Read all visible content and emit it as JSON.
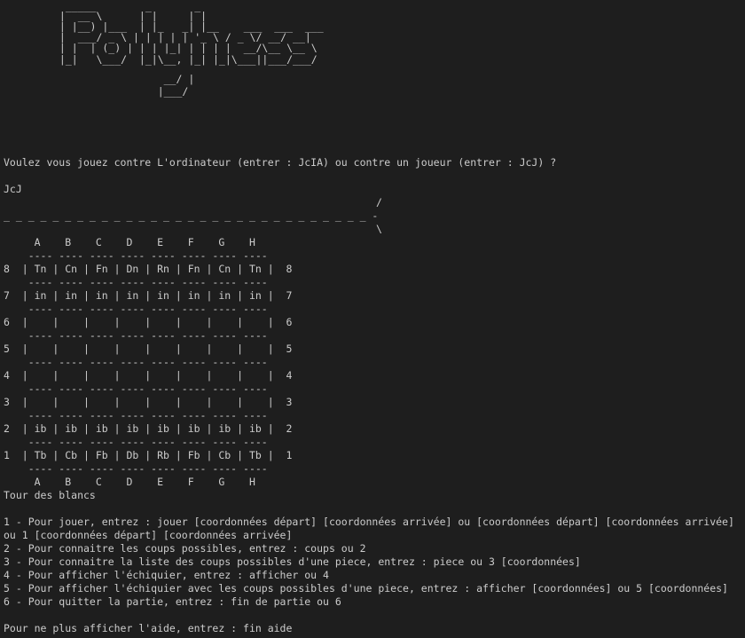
{
  "terminal": {
    "banner": [
      "  _____        _       _",
      " |  __ \\      | |     | |",
      " | |__) |___  | |_   _| |__    ___  ___  ___",
      " |  ___/ _ \\ | | | | | '_ \\ / _ \\/ __/ __|",
      " | |  | (_) | | | |_| | | | |  __/\\__ \\__ \\",
      " |_|   \\___/  |_|\\__, |_| |_|\\___||___/___/",
      "                  __/ |",
      "                 |___/"
    ],
    "prompt_mode": "Voulez vous jouez contre L'ordinateur (entrer : JcIA) ou contre un joueur (entrer : JcJ) ?",
    "user_input": "JcJ",
    "divider_slash": "/",
    "divider_dashes": "_ _ _ _ _ _ _ _ _ _ _ _ _ _ _ _ _ _ _ _ _ _ _ _ _ _ _ _ _ _ -",
    "divider_backslash": "\\",
    "board": {
      "col_header": "     A    B    C    D    E    F    G    H",
      "rows": [
        {
          "rank": "8",
          "text": "8  | Tn | Cn | Fn | Dn | Rn | Fn | Cn | Tn |  8"
        },
        {
          "rank": "7",
          "text": "7  | in | in | in | in | in | in | in | in |  7"
        },
        {
          "rank": "6",
          "text": "6  |    |    |    |    |    |    |    |    |  6"
        },
        {
          "rank": "5",
          "text": "5  |    |    |    |    |    |    |    |    |  5"
        },
        {
          "rank": "4",
          "text": "4  |    |    |    |    |    |    |    |    |  4"
        },
        {
          "rank": "3",
          "text": "3  |    |    |    |    |    |    |    |    |  3"
        },
        {
          "rank": "2",
          "text": "2  | ib | ib | ib | ib | ib | ib | ib | ib |  2"
        },
        {
          "rank": "1",
          "text": "1  | Tb | Cb | Fb | Db | Rb | Fb | Cb | Tb |  1"
        }
      ],
      "separator": "    ---- ---- ---- ---- ---- ---- ---- ----",
      "col_footer": "     A    B    C    D    E    F    G    H"
    },
    "turn": "Tour des blancs",
    "help": [
      "1 - Pour jouer, entrez : jouer [coordonnées départ] [coordonnées arrivée] ou [coordonnées départ] [coordonnées arrivée]",
      "ou 1 [coordonnées départ] [coordonnées arrivée]",
      "2 - Pour connaitre les coups possibles, entrez : coups ou 2",
      "3 - Pour connaitre la liste des coups possibles d'une piece, entrez : piece ou 3 [coordonnées]",
      "4 - Pour afficher l'échiquier, entrez : afficher ou 4",
      "5 - Pour afficher l'échiquier avec les coups possibles d'une piece, entrez : afficher [coordonnées] ou 5 [coordonnées]",
      "6 - Pour quitter la partie, entrez : fin de partie ou 6"
    ],
    "hide_help": "Pour ne plus afficher l'aide, entrez : fin aide"
  }
}
